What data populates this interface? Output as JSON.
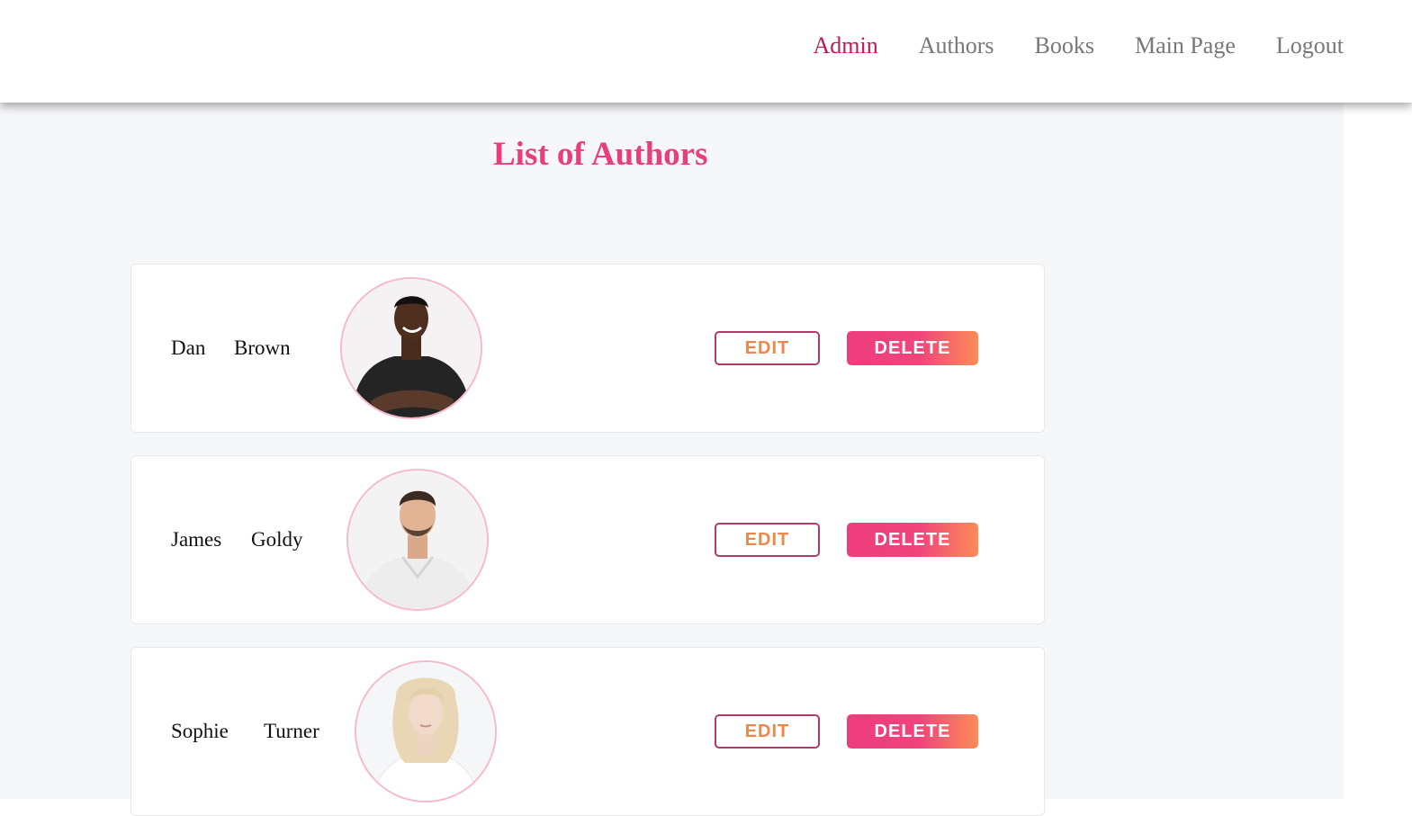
{
  "nav": {
    "links": [
      "Admin",
      "Authors",
      "Books",
      "Main Page",
      "Logout"
    ],
    "active": "Admin"
  },
  "page": {
    "title": "List of Authors"
  },
  "authors": [
    {
      "first_name": "Dan",
      "last_name": "Brown",
      "photo": "man-black-tshirt-arms-crossed"
    },
    {
      "first_name": "James",
      "last_name": "Goldy",
      "photo": "man-white-tshirt-beard"
    },
    {
      "first_name": "Sophie",
      "last_name": "Turner",
      "photo": "woman-blonde-white-top"
    }
  ],
  "buttons": {
    "edit_label": "EDIT",
    "delete_label": "DELETE"
  },
  "colors": {
    "accent": "#e83e79",
    "nav_active": "#c2185b",
    "edit_text": "#f0874a",
    "edit_border": "#b03a6a",
    "delete_gradient_start": "#ee3d7e",
    "delete_gradient_end": "#fb8c56",
    "avatar_ring": "#f7b9cc",
    "page_background": "#f6f7f9"
  }
}
